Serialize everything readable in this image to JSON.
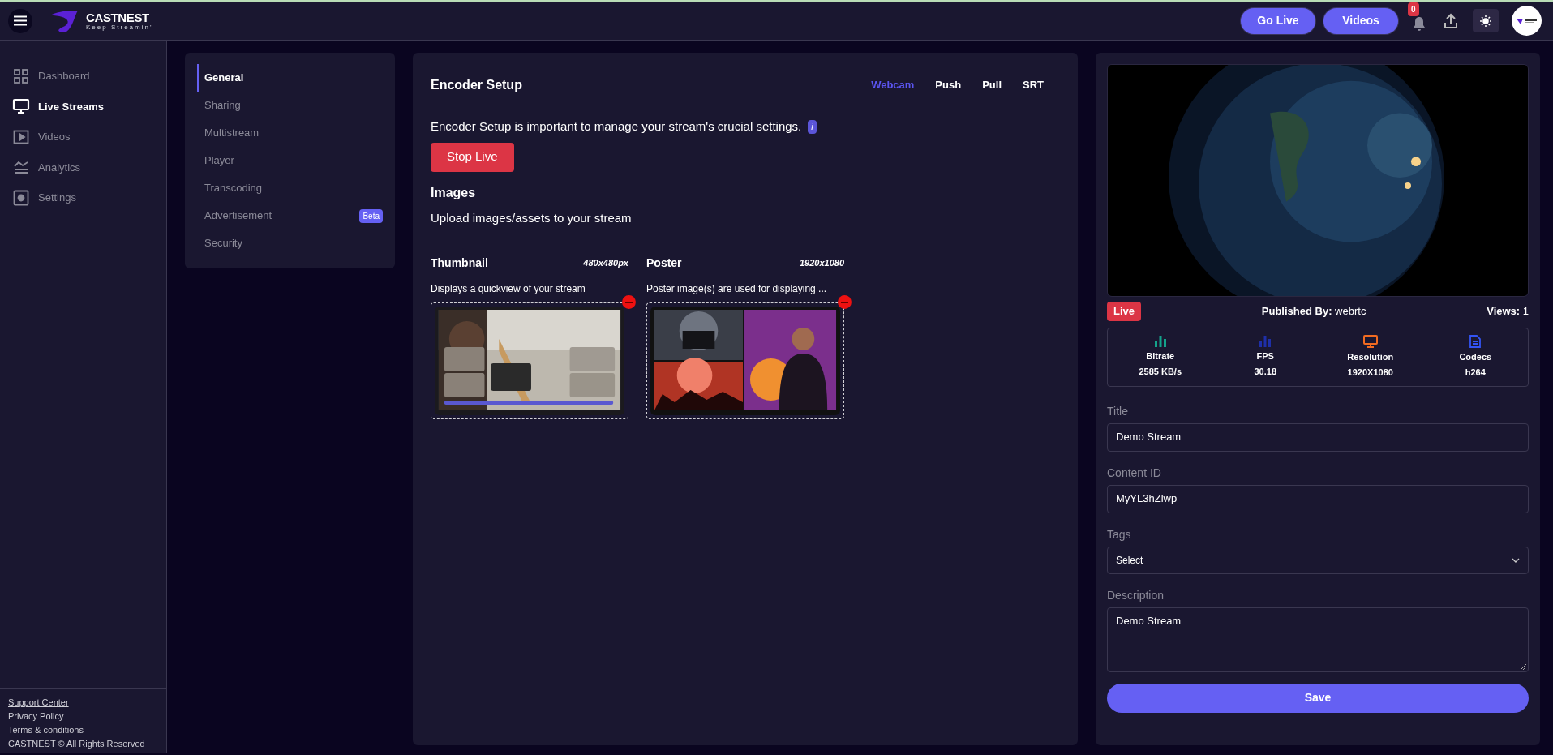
{
  "header": {
    "brand": "CASTNEST",
    "tagline": "Keep Streamin'",
    "buttons": [
      "Go Live",
      "Videos"
    ],
    "notification_count": "0"
  },
  "sidebar": {
    "items": [
      {
        "label": "Dashboard",
        "selected": false
      },
      {
        "label": "Live Streams",
        "selected": true
      },
      {
        "label": "Videos",
        "selected": false
      },
      {
        "label": "Analytics",
        "selected": false
      },
      {
        "label": "Settings",
        "selected": false
      }
    ],
    "footer": [
      {
        "label": "Support Center",
        "kind": "link"
      },
      {
        "label": "Privacy Policy",
        "kind": "text"
      },
      {
        "label": "Terms & conditions",
        "kind": "text"
      },
      {
        "label": "CASTNEST © All Rights Reserved",
        "kind": "text"
      }
    ]
  },
  "subnav": {
    "items": [
      {
        "label": "General",
        "selected": true
      },
      {
        "label": "Sharing",
        "selected": false
      },
      {
        "label": "Multistream",
        "selected": false
      },
      {
        "label": "Player",
        "selected": false
      },
      {
        "label": "Transcoding",
        "selected": false
      },
      {
        "label": "Advertisement",
        "selected": false,
        "badge": "Beta"
      },
      {
        "label": "Security",
        "selected": false
      }
    ]
  },
  "encoder": {
    "title": "Encoder Setup",
    "tabs": [
      {
        "label": "Webcam",
        "selected": true
      },
      {
        "label": "Push",
        "selected": false
      },
      {
        "label": "Pull",
        "selected": false
      },
      {
        "label": "SRT",
        "selected": false
      }
    ],
    "description": "Encoder Setup is important to manage your stream's crucial settings.",
    "info": "i",
    "stop_button": "Stop Live"
  },
  "images": {
    "title": "Images",
    "subtitle": "Upload images/assets to your stream",
    "slots": [
      {
        "title": "Thumbnail",
        "size": "480x480px",
        "description": "Displays a quickview of your stream"
      },
      {
        "title": "Poster",
        "size": "1920x1080",
        "description": "Poster image(s) are used for displaying ..."
      }
    ]
  },
  "preview": {
    "status": "Live",
    "published": "**Published By:** webrtc",
    "views": "**Views:** 1",
    "stats": [
      {
        "label": "Bitrate",
        "value": "2585 KB/s",
        "color": "#14a38b"
      },
      {
        "label": "FPS",
        "value": "30.18",
        "color": "#1e2fa8"
      },
      {
        "label": "Resolution",
        "value": "1920X1080",
        "color": "#f26b21"
      },
      {
        "label": "Codecs",
        "value": "h264",
        "color": "#3354f4"
      }
    ]
  },
  "form": {
    "fields": [
      {
        "label": "Title",
        "kind": "input",
        "value": "Demo Stream"
      },
      {
        "label": "Content ID",
        "kind": "input",
        "value": "MyYL3hZlwp"
      },
      {
        "label": "Tags",
        "kind": "select",
        "placeholder": "Select"
      },
      {
        "label": "Description",
        "kind": "textarea",
        "value": "Demo Stream"
      }
    ],
    "save": "Save"
  }
}
